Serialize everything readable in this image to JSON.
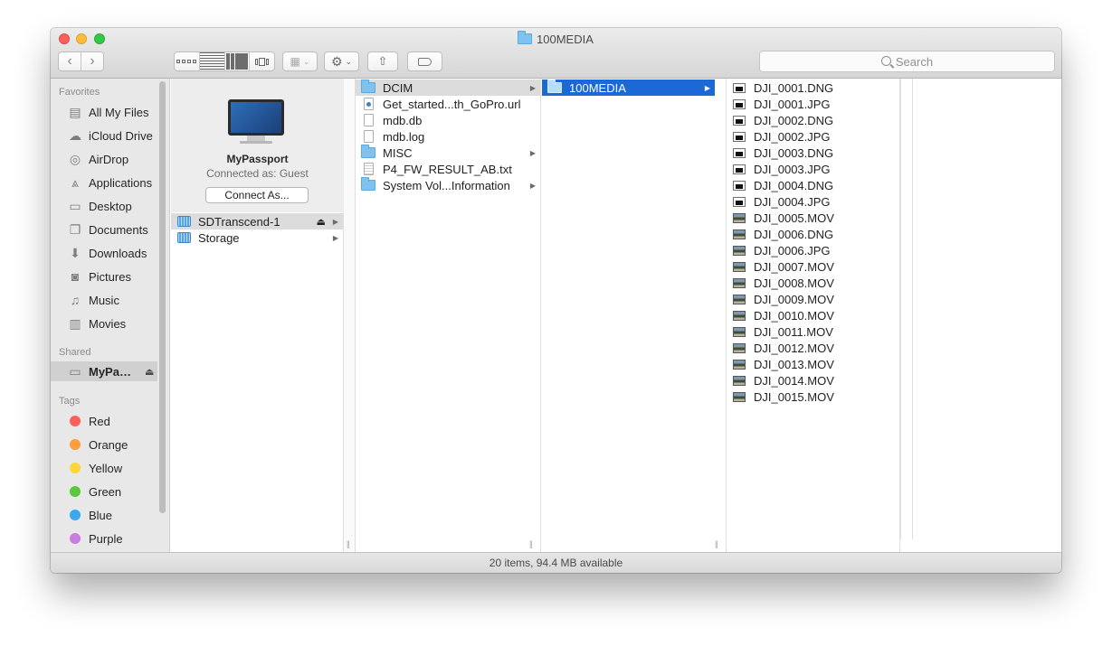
{
  "window": {
    "title": "100MEDIA"
  },
  "toolbar": {
    "search_placeholder": "Search"
  },
  "sidebar": {
    "favorites_header": "Favorites",
    "favorites": [
      {
        "label": "All My Files",
        "icon": "all-files-icon"
      },
      {
        "label": "iCloud Drive",
        "icon": "cloud-icon"
      },
      {
        "label": "AirDrop",
        "icon": "airdrop-icon"
      },
      {
        "label": "Applications",
        "icon": "applications-icon"
      },
      {
        "label": "Desktop",
        "icon": "desktop-icon"
      },
      {
        "label": "Documents",
        "icon": "documents-icon"
      },
      {
        "label": "Downloads",
        "icon": "downloads-icon"
      },
      {
        "label": "Pictures",
        "icon": "camera-icon"
      },
      {
        "label": "Music",
        "icon": "music-icon"
      },
      {
        "label": "Movies",
        "icon": "film-icon"
      }
    ],
    "shared_header": "Shared",
    "shared": [
      {
        "label": "MyPassport",
        "icon": "monitor-icon",
        "selected": true
      }
    ],
    "tags_header": "Tags",
    "tags": [
      {
        "label": "Red",
        "color": "#fc605b"
      },
      {
        "label": "Orange",
        "color": "#fd9e3a"
      },
      {
        "label": "Yellow",
        "color": "#fcd53a"
      },
      {
        "label": "Green",
        "color": "#59c83c"
      },
      {
        "label": "Blue",
        "color": "#3aa8f1"
      },
      {
        "label": "Purple",
        "color": "#cb7ddf"
      }
    ]
  },
  "server": {
    "name": "MyPassport",
    "connected_as": "Connected as: Guest",
    "connect_button": "Connect As..."
  },
  "column1": [
    {
      "label": "SDTranscend-1",
      "type": "drive",
      "eject": true,
      "highlight": true
    },
    {
      "label": "Storage",
      "type": "drive"
    }
  ],
  "column2": [
    {
      "label": "DCIM",
      "type": "folder",
      "arrow": true,
      "highlight": true
    },
    {
      "label": "Get_started...th_GoPro.url",
      "type": "url"
    },
    {
      "label": "mdb.db",
      "type": "doc"
    },
    {
      "label": "mdb.log",
      "type": "doc"
    },
    {
      "label": "MISC",
      "type": "folder",
      "arrow": true
    },
    {
      "label": "P4_FW_RESULT_AB.txt",
      "type": "txt"
    },
    {
      "label": "System Vol...Information",
      "type": "folder",
      "arrow": true
    }
  ],
  "column3": [
    {
      "label": "100MEDIA",
      "type": "folder",
      "arrow": true,
      "selected": true
    }
  ],
  "column4": [
    {
      "label": "DJI_0001.DNG",
      "type": "img"
    },
    {
      "label": "DJI_0001.JPG",
      "type": "img"
    },
    {
      "label": "DJI_0002.DNG",
      "type": "img"
    },
    {
      "label": "DJI_0002.JPG",
      "type": "img"
    },
    {
      "label": "DJI_0003.DNG",
      "type": "img"
    },
    {
      "label": "DJI_0003.JPG",
      "type": "img"
    },
    {
      "label": "DJI_0004.DNG",
      "type": "img"
    },
    {
      "label": "DJI_0004.JPG",
      "type": "img"
    },
    {
      "label": "DJI_0005.MOV",
      "type": "mov"
    },
    {
      "label": "DJI_0006.DNG",
      "type": "mov"
    },
    {
      "label": "DJI_0006.JPG",
      "type": "mov"
    },
    {
      "label": "DJI_0007.MOV",
      "type": "mov"
    },
    {
      "label": "DJI_0008.MOV",
      "type": "mov"
    },
    {
      "label": "DJI_0009.MOV",
      "type": "mov"
    },
    {
      "label": "DJI_0010.MOV",
      "type": "mov"
    },
    {
      "label": "DJI_0011.MOV",
      "type": "mov"
    },
    {
      "label": "DJI_0012.MOV",
      "type": "mov"
    },
    {
      "label": "DJI_0013.MOV",
      "type": "mov"
    },
    {
      "label": "DJI_0014.MOV",
      "type": "mov"
    },
    {
      "label": "DJI_0015.MOV",
      "type": "mov"
    }
  ],
  "statusbar": {
    "text": "20 items, 94.4 MB available"
  }
}
